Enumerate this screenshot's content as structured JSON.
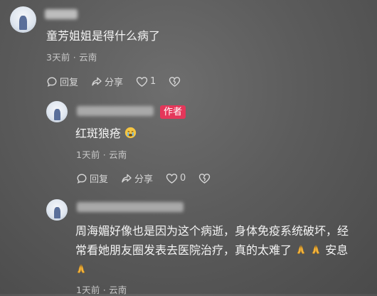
{
  "comments": [
    {
      "text": "童芳姐姐是得什么病了",
      "meta": "3天前 · 云南",
      "reply": "回复",
      "share": "分享",
      "likes": "1"
    },
    {
      "author_badge": "作者",
      "text": "红斑狼疮",
      "meta": "1天前 · 云南",
      "reply": "回复",
      "share": "分享",
      "likes": "0"
    },
    {
      "text_line1": "周海媚好像也是因为这个病逝，身体免疫系统破坏，经",
      "text_line2": "常看她朋友圈发表去医院治疗，真的太难了",
      "text_after": "安息",
      "meta": "1天前 · 云南"
    }
  ],
  "icons": [
    "comment-icon",
    "share-icon",
    "heart-icon",
    "broken-heart-icon",
    "crying-emoji-icon",
    "pray-emoji-icon"
  ]
}
